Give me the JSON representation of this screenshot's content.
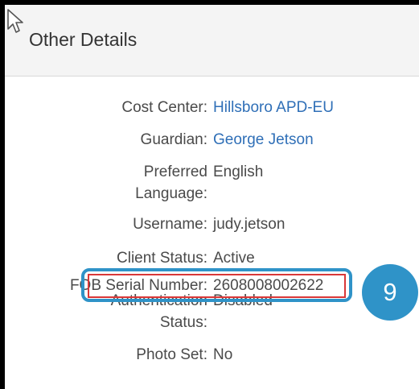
{
  "panel": {
    "title": "Other Details"
  },
  "fields": {
    "cost_center": {
      "label": "Cost Center:",
      "value": "Hillsboro APD-EU"
    },
    "guardian": {
      "label": "Guardian:",
      "value": "George Jetson"
    },
    "preferred_language": {
      "label_line1": "Preferred",
      "label_line2": "Language:",
      "value": "English"
    },
    "username": {
      "label": "Username:",
      "value": "judy.jetson"
    },
    "client_status": {
      "label": "Client Status:",
      "value": "Active"
    },
    "fob_serial": {
      "label": "FOB Serial Number:",
      "value": "2608008002622"
    },
    "authentication_status": {
      "label_line1": "Authentication",
      "label_line2": "Status:",
      "value": "Disabled"
    },
    "photo_set": {
      "label": "Photo Set:",
      "value": "No"
    }
  },
  "callout": {
    "step": "9"
  },
  "colors": {
    "link": "#2f6fb7",
    "callout_blue": "#2f93c8",
    "highlight_red": "#d93838"
  },
  "icons": {
    "cursor": "mouse-pointer-icon"
  }
}
